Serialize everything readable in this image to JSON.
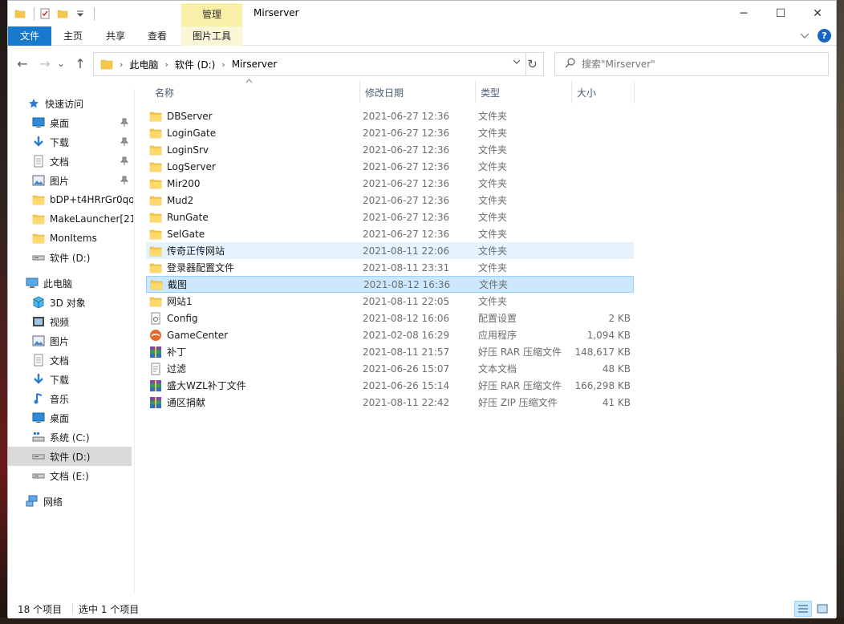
{
  "title_bar": {
    "context_tab": "管理",
    "window_title": "Mirserver",
    "minimize": "─",
    "maximize": "☐",
    "close": "✕"
  },
  "ribbon": {
    "tabs": [
      "文件",
      "主页",
      "共享",
      "查看",
      "图片工具"
    ],
    "expand_icon": "chevron-down-icon",
    "help": "?"
  },
  "navigation": {
    "back": "←",
    "forward": "→",
    "recent": "⌄",
    "up": "↑",
    "breadcrumb": [
      "此电脑",
      "软件 (D:)",
      "Mirserver"
    ],
    "refresh": "↻",
    "search_placeholder": "搜索\"Mirserver\""
  },
  "sidebar": {
    "quick_access": "快速访问",
    "quick_items": [
      {
        "label": "桌面",
        "icon": "desktop-icon",
        "pinned": true
      },
      {
        "label": "下载",
        "icon": "download-icon",
        "pinned": true
      },
      {
        "label": "文档",
        "icon": "document-icon",
        "pinned": true
      },
      {
        "label": "图片",
        "icon": "picture-icon",
        "pinned": true
      },
      {
        "label": "bDP+t4HRrGr0qq",
        "icon": "folder-icon",
        "pinned": false
      },
      {
        "label": "MakeLauncher[21",
        "icon": "folder-icon",
        "pinned": false
      },
      {
        "label": "MonItems",
        "icon": "folder-icon",
        "pinned": false
      },
      {
        "label": "软件 (D:)",
        "icon": "drive-icon",
        "pinned": false
      }
    ],
    "this_pc": "此电脑",
    "pc_items": [
      {
        "label": "3D 对象",
        "icon": "3d-objects-icon"
      },
      {
        "label": "视频",
        "icon": "video-icon"
      },
      {
        "label": "图片",
        "icon": "picture-icon"
      },
      {
        "label": "文档",
        "icon": "document-icon"
      },
      {
        "label": "下载",
        "icon": "download-icon"
      },
      {
        "label": "音乐",
        "icon": "music-icon"
      },
      {
        "label": "桌面",
        "icon": "desktop-icon"
      },
      {
        "label": "系统 (C:)",
        "icon": "system-drive-icon"
      },
      {
        "label": "软件 (D:)",
        "icon": "drive-icon"
      },
      {
        "label": "文档 (E:)",
        "icon": "drive-icon"
      }
    ],
    "selected_pc_item": "软件 (D:)",
    "network": "网络"
  },
  "columns": {
    "name": "名称",
    "date": "修改日期",
    "type": "类型",
    "size": "大小"
  },
  "files": [
    {
      "name": "DBServer",
      "date": "2021-06-27 12:36",
      "type": "文件夹",
      "size": "",
      "icon": "folder-icon"
    },
    {
      "name": "LoginGate",
      "date": "2021-06-27 12:36",
      "type": "文件夹",
      "size": "",
      "icon": "folder-icon"
    },
    {
      "name": "LoginSrv",
      "date": "2021-06-27 12:36",
      "type": "文件夹",
      "size": "",
      "icon": "folder-icon"
    },
    {
      "name": "LogServer",
      "date": "2021-06-27 12:36",
      "type": "文件夹",
      "size": "",
      "icon": "folder-icon"
    },
    {
      "name": "Mir200",
      "date": "2021-06-27 12:36",
      "type": "文件夹",
      "size": "",
      "icon": "folder-icon"
    },
    {
      "name": "Mud2",
      "date": "2021-06-27 12:36",
      "type": "文件夹",
      "size": "",
      "icon": "folder-icon"
    },
    {
      "name": "RunGate",
      "date": "2021-06-27 12:36",
      "type": "文件夹",
      "size": "",
      "icon": "folder-icon"
    },
    {
      "name": "SelGate",
      "date": "2021-06-27 12:36",
      "type": "文件夹",
      "size": "",
      "icon": "folder-icon"
    },
    {
      "name": "传奇正传网站",
      "date": "2021-08-11 22:06",
      "type": "文件夹",
      "size": "",
      "icon": "folder-icon",
      "state": "hover"
    },
    {
      "name": "登录器配置文件",
      "date": "2021-08-11 23:31",
      "type": "文件夹",
      "size": "",
      "icon": "folder-icon"
    },
    {
      "name": "截图",
      "date": "2021-08-12 16:36",
      "type": "文件夹",
      "size": "",
      "icon": "folder-icon",
      "state": "selected"
    },
    {
      "name": "网站1",
      "date": "2021-08-11 22:05",
      "type": "文件夹",
      "size": "",
      "icon": "folder-icon"
    },
    {
      "name": "Config",
      "date": "2021-08-12 16:06",
      "type": "配置设置",
      "size": "2 KB",
      "icon": "config-file-icon"
    },
    {
      "name": "GameCenter",
      "date": "2021-02-08 16:29",
      "type": "应用程序",
      "size": "1,094 KB",
      "icon": "application-icon"
    },
    {
      "name": "补丁",
      "date": "2021-08-11 21:57",
      "type": "好压 RAR 压缩文件",
      "size": "148,617 KB",
      "icon": "archive-icon"
    },
    {
      "name": "过滤",
      "date": "2021-06-26 15:07",
      "type": "文本文档",
      "size": "48 KB",
      "icon": "text-file-icon"
    },
    {
      "name": "盛大WZL补丁文件",
      "date": "2021-06-26 15:14",
      "type": "好压 RAR 压缩文件",
      "size": "166,298 KB",
      "icon": "archive-icon"
    },
    {
      "name": "通区捐献",
      "date": "2021-08-11 22:42",
      "type": "好压 ZIP 压缩文件",
      "size": "41 KB",
      "icon": "archive-icon"
    }
  ],
  "status": {
    "item_count": "18 个项目",
    "selection": "选中 1 个项目"
  },
  "colors": {
    "accent": "#1979ca",
    "selected_row": "#cce8ff",
    "hover_row": "#e5f3ff",
    "folder": "#f5c84c",
    "context_tab": "#f8f0a8"
  }
}
